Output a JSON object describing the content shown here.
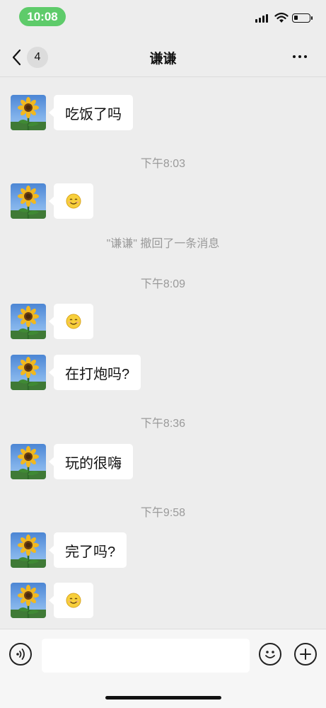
{
  "status_bar": {
    "time": "10:08"
  },
  "nav": {
    "title": "谦谦",
    "back_badge": "4"
  },
  "messages": [
    {
      "text": "吃饭了吗"
    },
    {
      "timestamp": "下午8:03"
    },
    {
      "emoji": "smile-emoji"
    },
    {
      "system": "\"谦谦\" 撤回了一条消息"
    },
    {
      "timestamp": "下午8:09"
    },
    {
      "emoji": "smile-emoji"
    },
    {
      "text": "在打炮吗?"
    },
    {
      "timestamp": "下午8:36"
    },
    {
      "text": "玩的很嗨"
    },
    {
      "timestamp": "下午9:58"
    },
    {
      "text": "完了吗?"
    },
    {
      "emoji": "smile-emoji"
    }
  ],
  "input": {
    "placeholder": ""
  },
  "colors": {
    "time_pill": "#5ecb6a",
    "background": "#ededed",
    "bubble": "#ffffff",
    "system_text": "#9a9a9a"
  }
}
